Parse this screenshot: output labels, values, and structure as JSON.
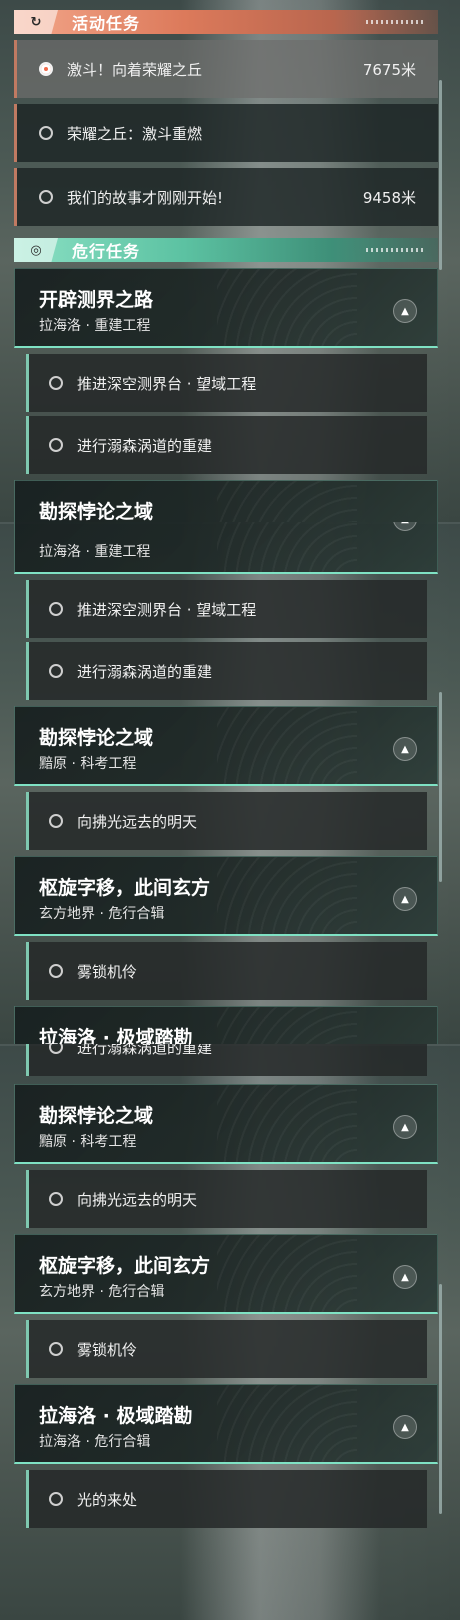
{
  "sections": {
    "active_title": "活动任务",
    "danger_title": "危行任务",
    "header_deco": "ＳＯＭＥＲＳ ＷＯＥＫＯＬＬＡ"
  },
  "active_tasks": [
    {
      "label": "激斗！向着荣耀之丘",
      "dist": "7675米",
      "selected": true
    },
    {
      "label": "荣耀之丘：激斗重燃",
      "dist": "",
      "selected": false
    },
    {
      "label": "我们的故事才刚刚开始!",
      "dist": "9458米",
      "selected": false
    }
  ],
  "groups": [
    {
      "title": "开辟测界之路",
      "subtitle": "拉海洛 · 重建工程",
      "items": [
        "推进深空测界台 · 望域工程",
        "进行溺森涡道的重建"
      ]
    },
    {
      "title": "勘探悖论之域",
      "subtitle": "黯原 · 科考工程",
      "items": [
        "向拂光远去的明天"
      ]
    },
    {
      "title": "枢旋字移，此间玄方",
      "subtitle": "玄方地界 · 危行合辑",
      "items": [
        "雾锁机伶"
      ]
    },
    {
      "title": "拉海洛 · 极域踏勘",
      "subtitle": "拉海洛 · 危行合辑",
      "items": [
        "光的来处"
      ]
    }
  ],
  "partial": {
    "peek_title_1": "勘探悖论之域",
    "peek_title_2": "拉海洛 · 极域踏勘"
  },
  "icons": {
    "active": "activity-icon",
    "danger": "radar-icon",
    "collapse": "chevron-up-icon"
  },
  "colors": {
    "accent_orange": "#dc7a5b",
    "accent_green": "#5cc2a2"
  }
}
